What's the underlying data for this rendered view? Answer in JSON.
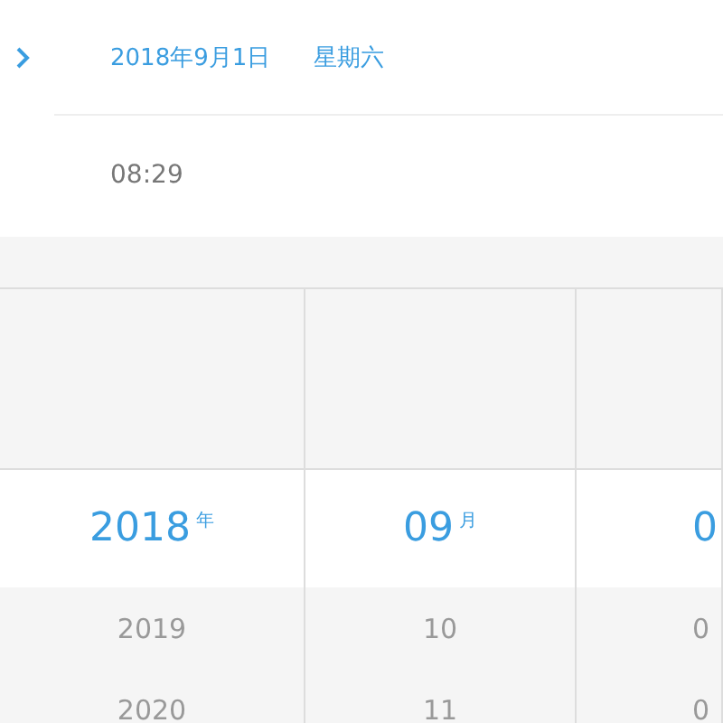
{
  "date_row": {
    "date": "2018年9月1日",
    "weekday": "星期六"
  },
  "time_row": {
    "time": "08:29"
  },
  "picker": {
    "columns": [
      {
        "selected_value": "2018",
        "unit": "年",
        "values_below": [
          "2019",
          "2020"
        ]
      },
      {
        "selected_value": "09",
        "unit": "月",
        "values_below": [
          "10",
          "11"
        ]
      },
      {
        "selected_value": "0",
        "values_below": [
          "0",
          "0"
        ]
      }
    ]
  }
}
